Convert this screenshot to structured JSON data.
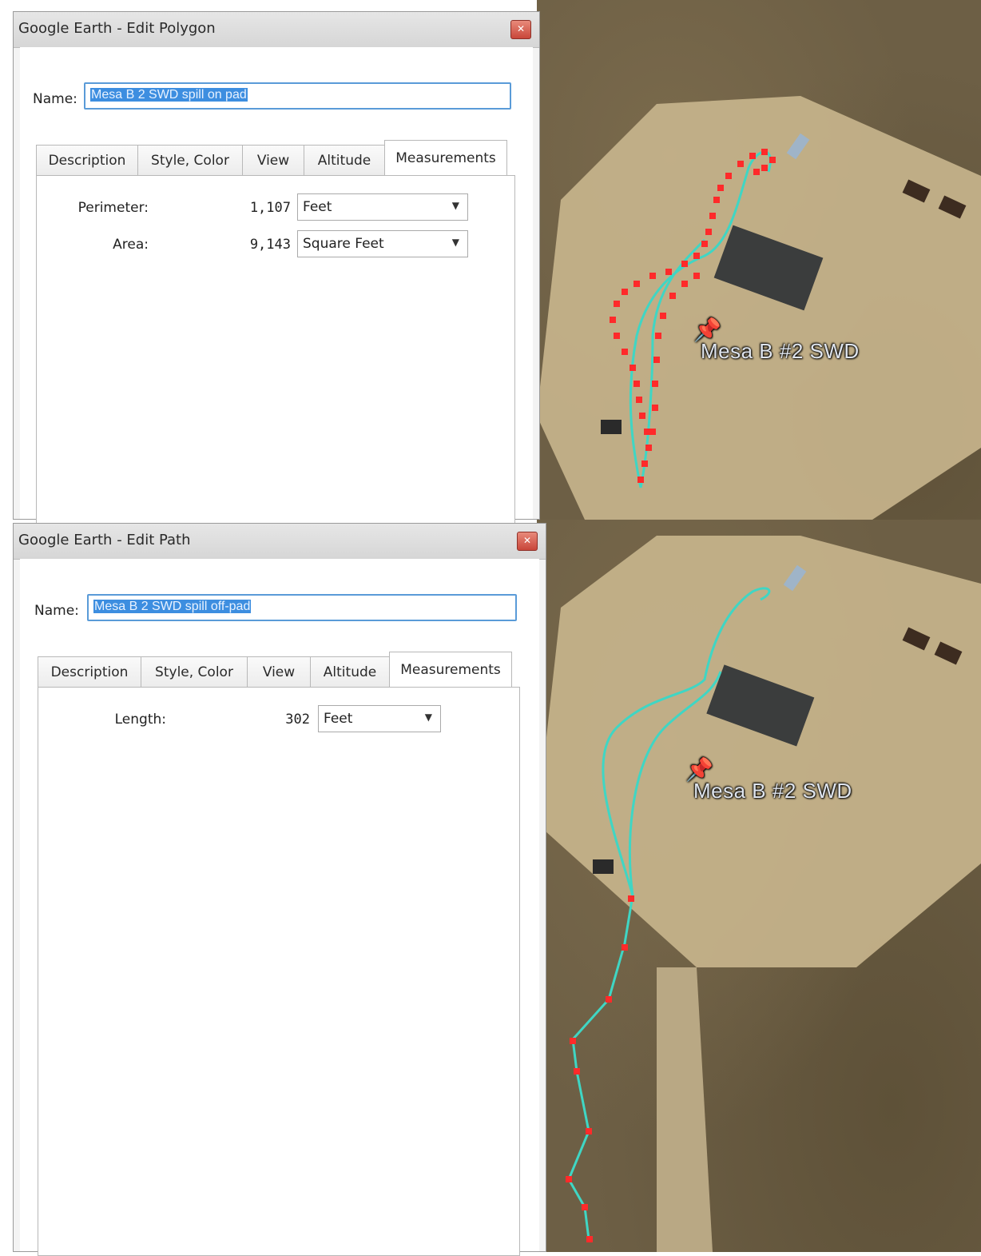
{
  "polygon_dialog": {
    "title": "Google Earth - Edit Polygon",
    "close_glyph": "✕",
    "name_label": "Name:",
    "name_value": "Mesa B 2 SWD spill on pad",
    "tabs": [
      "Description",
      "Style, Color",
      "View",
      "Altitude",
      "Measurements"
    ],
    "active_tab": "Measurements",
    "measurements": [
      {
        "label": "Perimeter:",
        "value": "1,107",
        "unit": "Feet"
      },
      {
        "label": "Area:",
        "value": "9,143",
        "unit": "Square Feet"
      }
    ],
    "dropdown_arrow": "▼"
  },
  "path_dialog": {
    "title": "Google Earth - Edit Path",
    "close_glyph": "✕",
    "name_label": "Name:",
    "name_value": "Mesa B 2 SWD spill off-pad",
    "tabs": [
      "Description",
      "Style, Color",
      "View",
      "Altitude",
      "Measurements"
    ],
    "active_tab": "Measurements",
    "measurements": [
      {
        "label": "Length:",
        "value": "302",
        "unit": "Feet"
      }
    ],
    "dropdown_arrow": "▼"
  },
  "map_top": {
    "placemark_label": "Mesa B #2 SWD",
    "icon": "pushpin-icon"
  },
  "map_bottom": {
    "placemark_label": "Mesa B #2 SWD",
    "icon": "pushpin-icon"
  },
  "colors": {
    "path_line": "#3fd6c4",
    "vertex": "#ff2a2a",
    "pin": "#2f5fd8",
    "selection": "#3d8ee0"
  }
}
